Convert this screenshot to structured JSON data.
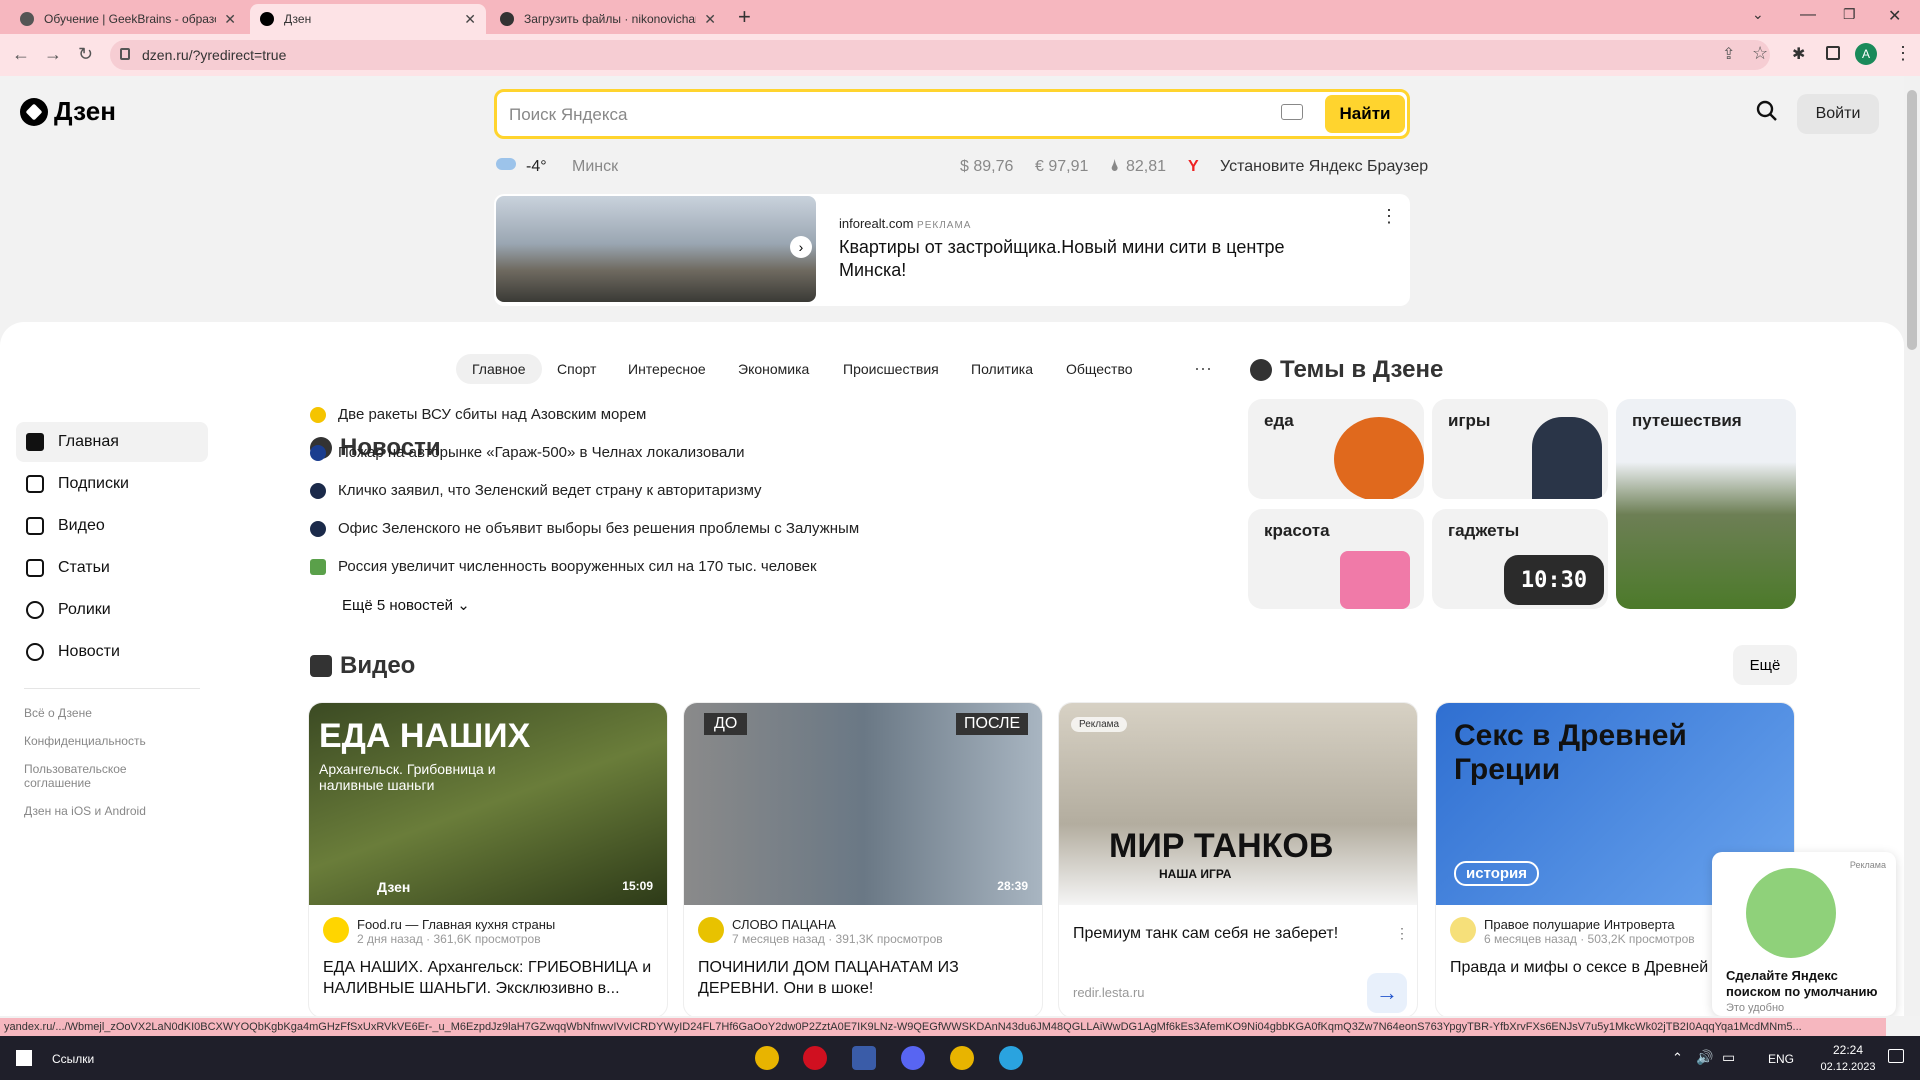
{
  "browser": {
    "tabs": [
      {
        "title": "Обучение | GeekBrains - образо",
        "icon_color": "#555"
      },
      {
        "title": "Дзен",
        "icon_color": "#000"
      },
      {
        "title": "Загрузить файлы · nikonovichar",
        "icon_color": "#333"
      }
    ],
    "url": "dzen.ru/?yredirect=true",
    "status_url": "yandex.ru/.../Wbmejl_zOoVX2LaN0dKI0BCXWYOQbKgbKga4mGHzFfSxUxRVkVE6Er-_u_M6EzpdJz9laH7GZwqqWbNfnwvIVvICRDYWyID24FL7Hf6GaOoY2dw0P2ZztA0E7IK9LNz-W9QEGfWWSKDAnN43du6JM48QGLLAiWwDG1AgMf6kEs3AfemKO9Ni04gbbKGA0fKqmQ3Zw7N64eonS763YpgyTBR-YfbXrvFXs6ENJsV7u5y1MkcWk02jTB2I0AqqYqa1McdMNm5..."
  },
  "header": {
    "logo": "Дзен",
    "search_placeholder": "Поиск Яндекса",
    "search_button": "Найти",
    "login": "Войти",
    "weather_temp": "-4°",
    "city": "Минск",
    "usd": "$ 89,76",
    "eur": "€ 97,91",
    "oil": "82,81",
    "browser_promo": "Установите Яндекс Браузер"
  },
  "ad": {
    "source": "inforealt.com",
    "badge": "РЕКЛАМА",
    "title": "Квартиры от застройщика.Новый мини сити в центре Минска!"
  },
  "sidebar": {
    "items": [
      {
        "label": "Главная"
      },
      {
        "label": "Подписки"
      },
      {
        "label": "Видео"
      },
      {
        "label": "Статьи"
      },
      {
        "label": "Ролики"
      },
      {
        "label": "Новости"
      }
    ],
    "footer": [
      "Всё о Дзене",
      "Конфиденциальность",
      "Пользовательское соглашение",
      "Дзен на iOS и Android"
    ]
  },
  "news": {
    "title": "Новости",
    "tabs": [
      "Главное",
      "Спорт",
      "Интересное",
      "Экономика",
      "Происшествия",
      "Политика",
      "Общество"
    ],
    "items": [
      {
        "text": "Две ракеты ВСУ сбиты над Азовским морем",
        "color": "#f5c400"
      },
      {
        "text": "Пожар на авторынке «Гараж-500» в Челнах локализовали",
        "color": "#1a3d8f"
      },
      {
        "text": "Кличко заявил, что Зеленский ведет страну к авторитаризму",
        "color": "#1b2a4a"
      },
      {
        "text": "Офис Зеленского не объявит выборы без решения проблемы с Залужным",
        "color": "#1b2a4a"
      },
      {
        "text": "Россия увеличит численность вооруженных сил на 170 тыс. человек",
        "color": "#5aa04a"
      }
    ],
    "more": "Ещё 5 новостей"
  },
  "themes": {
    "title": "Темы в Дзене",
    "items": [
      "еда",
      "игры",
      "путешествия",
      "красота",
      "гаджеты"
    ],
    "clock": "10:30"
  },
  "video": {
    "title": "Видео",
    "more": "Ещё",
    "cards": [
      {
        "overlay": "ЕДА НАШИХ",
        "sub": "Архангельск. Грибовница и наливные шаньги",
        "brand": "Дзен",
        "duration": "15:09",
        "channel": "Food.ru — Главная кухня страны",
        "meta": "2 дня назад · 361,6K просмотров",
        "title": "ЕДА НАШИХ. Архангельск: ГРИБОВНИЦА и НАЛИВНЫЕ ШАНЬГИ. Эксклюзивно в..."
      },
      {
        "before": "ДО",
        "after": "ПОСЛЕ",
        "duration": "28:39",
        "channel": "СЛОВО ПАЦАНА",
        "meta": "7 месяцев назад · 391,3K просмотров",
        "title": "ПОЧИНИЛИ ДОМ ПАЦАНАТАМ ИЗ ДЕРЕВНИ. Они в шоке!"
      },
      {
        "badge": "Реклама",
        "overlay": "МИР ТАНКОВ",
        "sub": "НАША ИГРА",
        "title": "Премиум танк сам себя не заберет!",
        "domain": "redir.lesta.ru"
      },
      {
        "overlay": "Секс в Древней Греции",
        "tag": "история",
        "channel": "Правое полушарие Интроверта",
        "meta": "6 месяцев назад · 503,2K просмотров",
        "title": "Правда и мифы о сексе в Древней"
      }
    ]
  },
  "popup": {
    "badge": "Реклама",
    "title": "Сделайте Яндекс поиском по умолчанию",
    "sub": "Это удобно"
  },
  "taskbar": {
    "links": "Ссылки",
    "lang": "ENG",
    "time": "22:24",
    "date": "02.12.2023"
  }
}
